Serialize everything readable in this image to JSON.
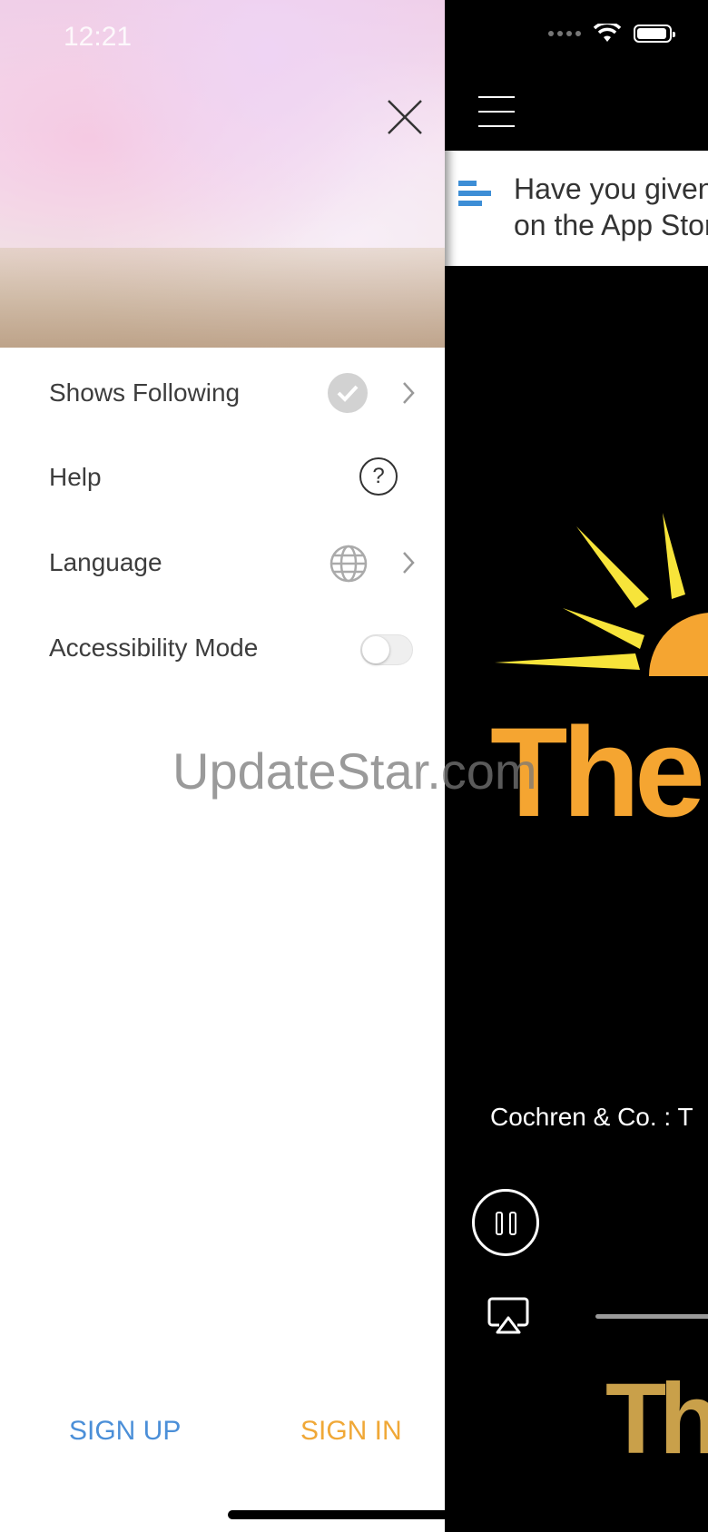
{
  "status_bar": {
    "time": "12:21"
  },
  "banner": {
    "text": "Have you given us a review on the App Store?"
  },
  "player": {
    "now_playing": "Cochren & Co. : T",
    "logo_text": "The",
    "bottom_logo_text": "Th"
  },
  "drawer": {
    "menu": [
      {
        "label": "Shows Following",
        "icon": "check-circle-icon"
      },
      {
        "label": "Help",
        "icon": "help-icon"
      },
      {
        "label": "Language",
        "icon": "globe-icon"
      },
      {
        "label": "Accessibility Mode",
        "icon": "toggle",
        "toggle_on": false
      }
    ],
    "sign_up": "SIGN UP",
    "sign_in": "SIGN IN"
  },
  "watermark": "UpdateStar.com",
  "colors": {
    "accent_blue": "#4b8fd8",
    "accent_orange": "#f0a837",
    "logo_orange": "#f5a531"
  }
}
